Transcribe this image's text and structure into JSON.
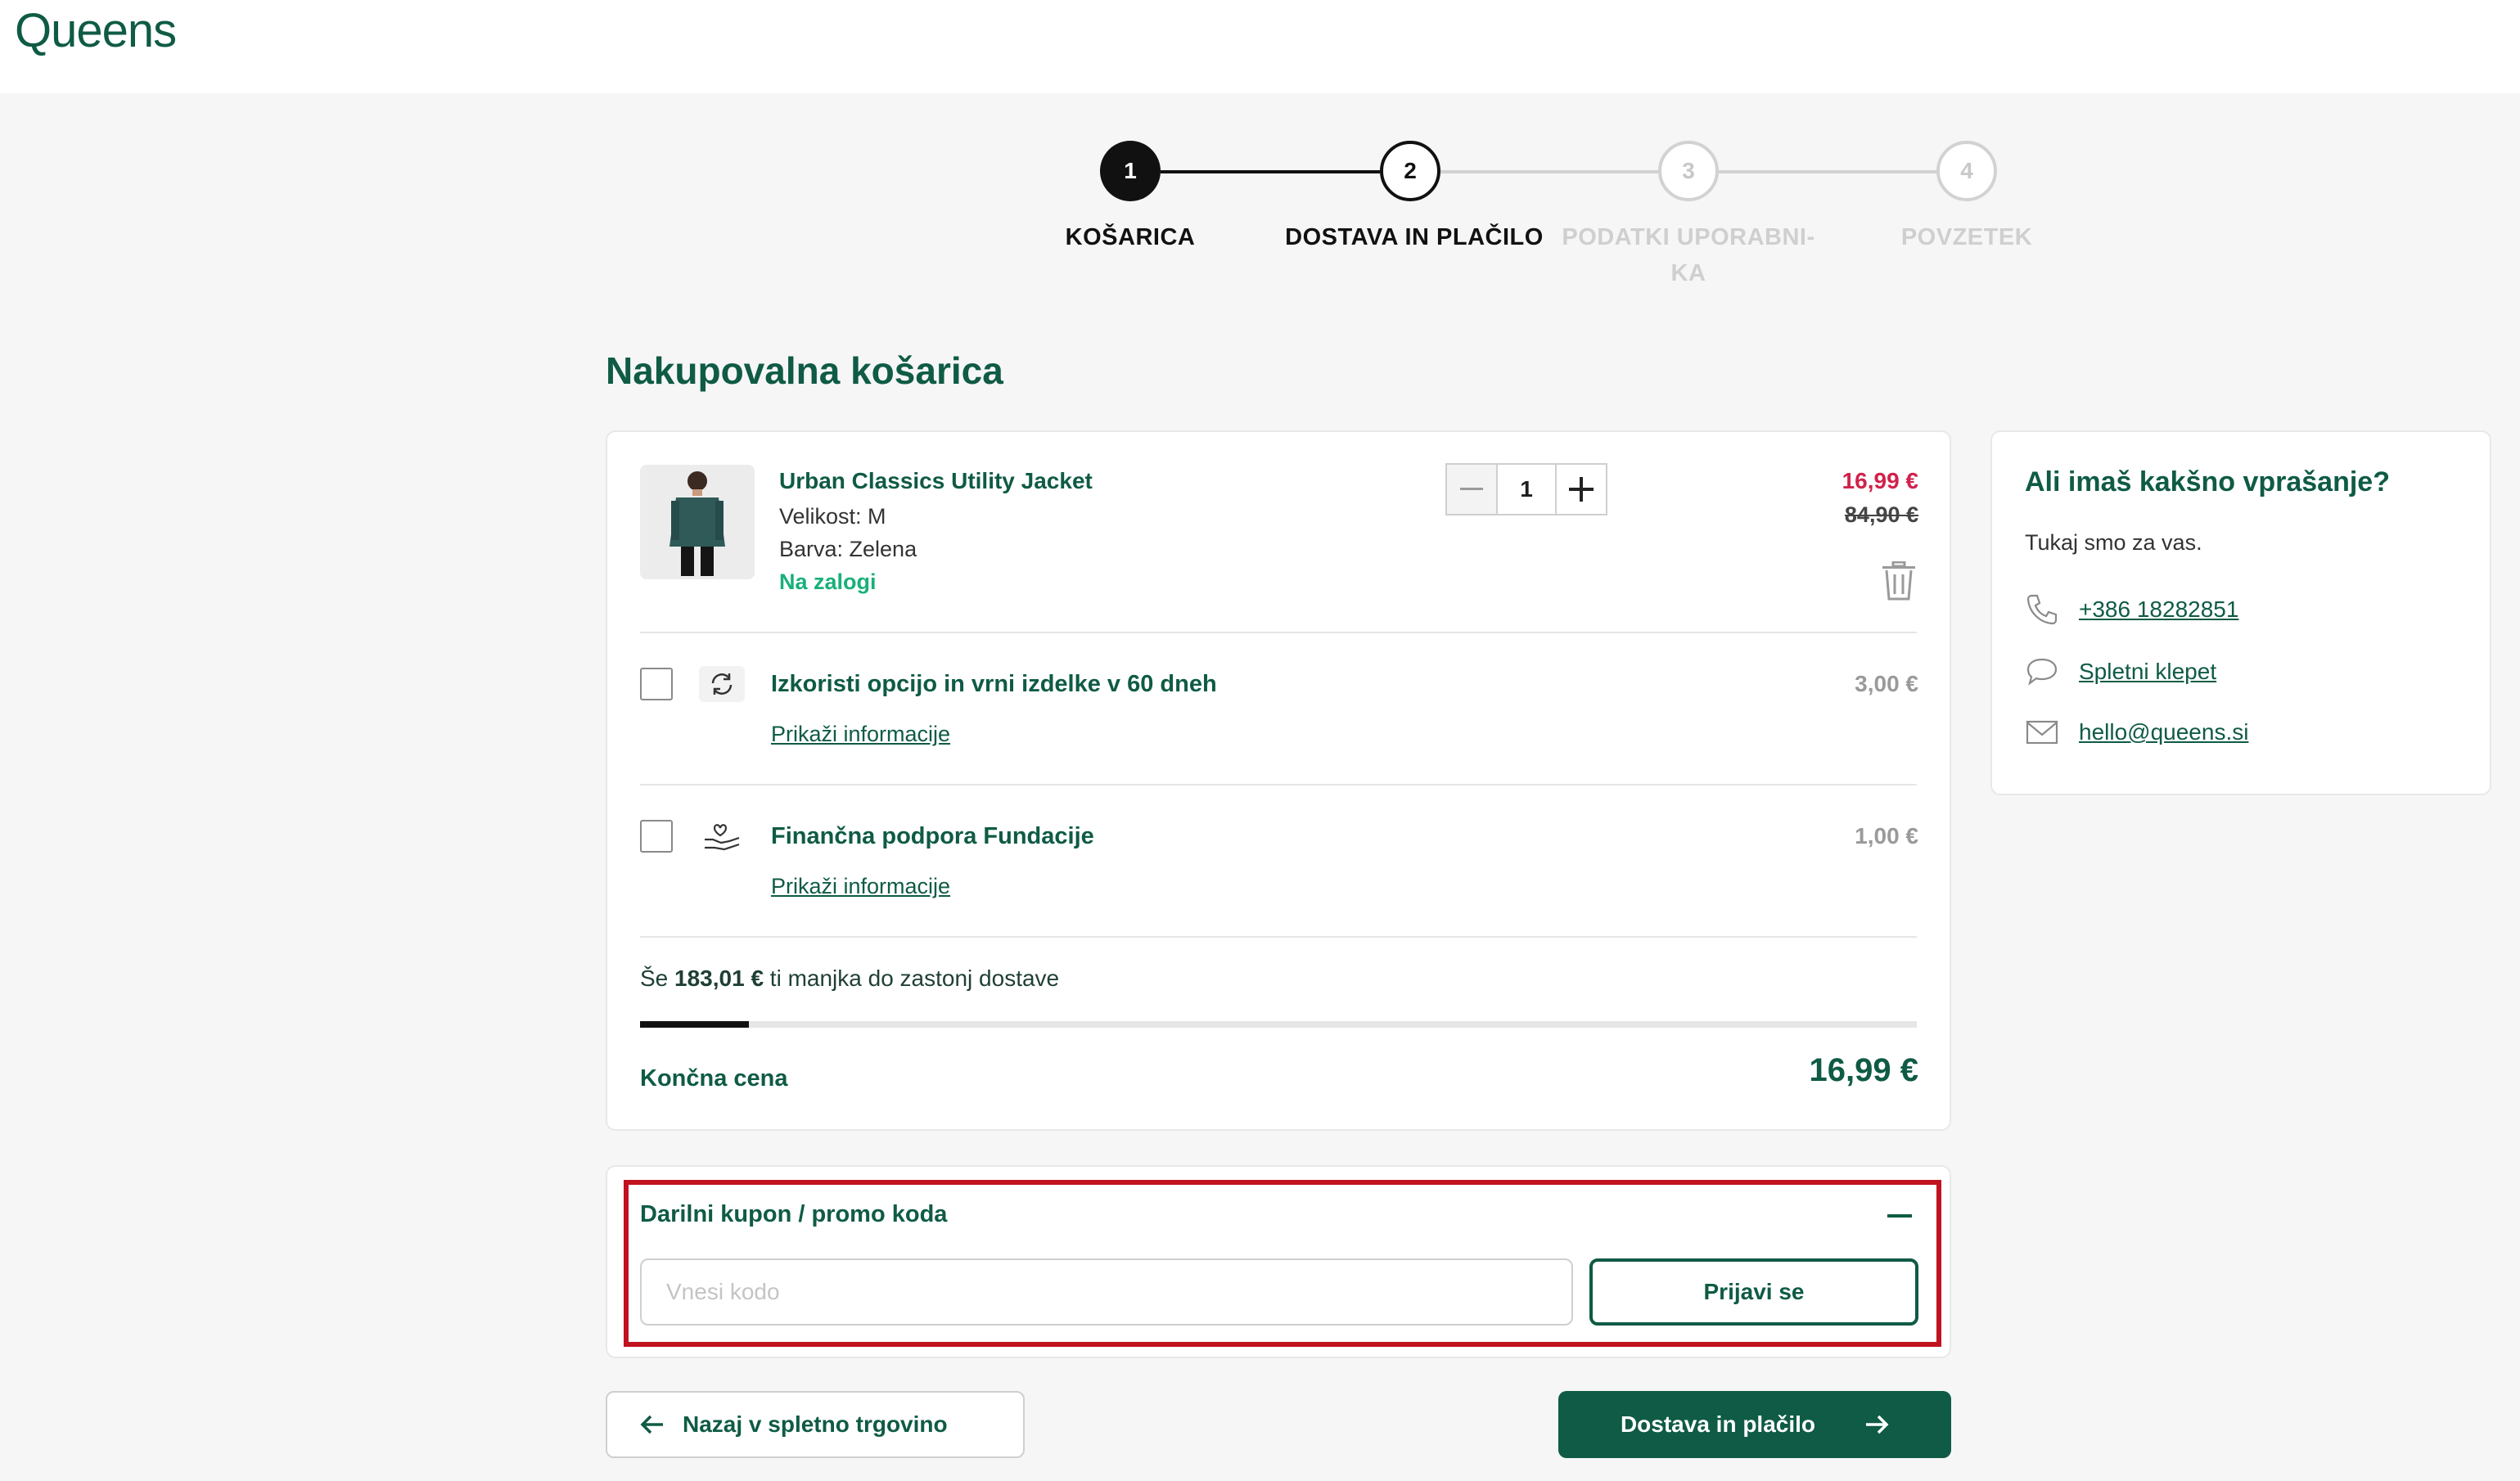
{
  "header": {
    "logo": "Queens"
  },
  "stepper": {
    "steps": [
      {
        "number": "1",
        "label": "KOŠARICA"
      },
      {
        "number": "2",
        "label": "DOSTAVA IN PLAČILO"
      },
      {
        "number": "3",
        "label": "PODATKI UPORABNI-KA"
      },
      {
        "number": "4",
        "label": "POVZETEK"
      }
    ]
  },
  "cart": {
    "title": "Nakupovalna košarica",
    "product": {
      "name": "Urban Classics Utility Jacket",
      "size": "Velikost: M",
      "color": "Barva: Zelena",
      "stock": "Na zalogi",
      "quantity": "1",
      "price_now": "16,99 €",
      "price_old": "84,90 €"
    },
    "options": [
      {
        "title": "Izkoristi opcijo in vrni izdelke v 60 dneh",
        "link": "Prikaži informacije",
        "price": "3,00 €"
      },
      {
        "title": "Finančna podpora Fundacije",
        "link": "Prikaži informacije",
        "price": "1,00 €"
      }
    ],
    "shipping": {
      "prefix": "Še ",
      "amount": "183,01 €",
      "suffix": " ti manjka do zastonj dostave",
      "progress": 0.085
    },
    "total": {
      "label": "Končna cena",
      "value": "16,99 €"
    }
  },
  "coupon": {
    "title": "Darilni kupon / promo koda",
    "placeholder": "Vnesi kodo",
    "button": "Prijavi se"
  },
  "nav": {
    "back": "Nazaj v spletno trgovino",
    "next": "Dostava in plačilo"
  },
  "help": {
    "title": "Ali imaš kakšno vprašanje?",
    "subtitle": "Tukaj smo za vas.",
    "phone": "+386 18282851",
    "chat": "Spletni klepet",
    "email": "hello@queens.si"
  },
  "colors": {
    "brand": "#0f5b45",
    "sale": "#d0224b",
    "stock": "#18b07a",
    "highlight": "#c1121f"
  }
}
